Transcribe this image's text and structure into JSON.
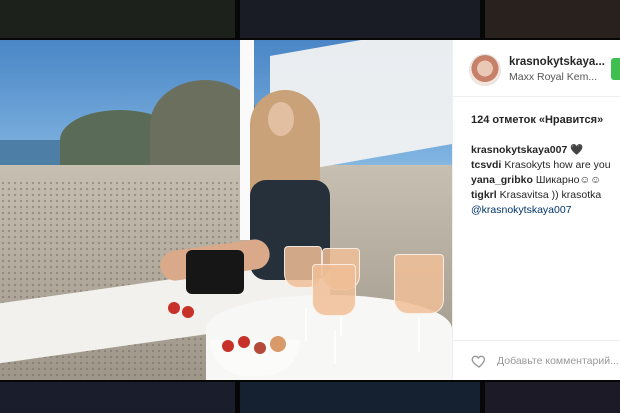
{
  "post": {
    "username": "krasnokytskaya...",
    "location": "Maxx Royal Kem...",
    "likes": "124 отметок «Нравится»",
    "comments": [
      {
        "author": "krasnokytskaya007",
        "text": "🖤"
      },
      {
        "author": "tcsvdi",
        "text": "Krasokyts how are you"
      },
      {
        "author": "yana_gribko",
        "text": "Шикарно☺☺"
      },
      {
        "author": "tigkrl",
        "text": "Krasavitsa )) krasotka"
      },
      {
        "author": "",
        "text": "@krasnokytskaya007"
      }
    ],
    "add_comment_placeholder": "Добавьте комментарий...",
    "heart_icon": "heart-outline-icon"
  },
  "colors": {
    "follow_button": "#3fbf4f",
    "text": "#262626",
    "link": "#003569"
  }
}
